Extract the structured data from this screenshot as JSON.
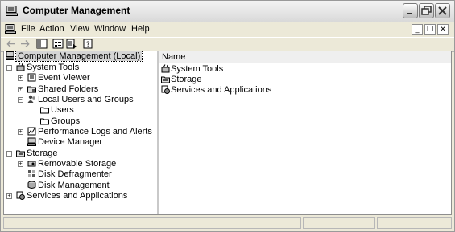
{
  "window": {
    "title": "Computer Management"
  },
  "menu": [
    "File",
    "Action",
    "View",
    "Window",
    "Help"
  ],
  "tree": {
    "root": "Computer Management (Local)",
    "system_tools": "System Tools",
    "event_viewer": "Event Viewer",
    "shared_folders": "Shared Folders",
    "local_users_groups": "Local Users and Groups",
    "users": "Users",
    "groups": "Groups",
    "perf_logs": "Performance Logs and Alerts",
    "device_manager": "Device Manager",
    "storage": "Storage",
    "removable_storage": "Removable Storage",
    "disk_defrag": "Disk Defragmenter",
    "disk_management": "Disk Management",
    "services_apps": "Services and Applications"
  },
  "list": {
    "column_name": "Name",
    "items": [
      "System Tools",
      "Storage",
      "Services and Applications"
    ]
  },
  "colors": {
    "selected_bg": "#d5d5d5",
    "window_bg": "#ece9d8"
  }
}
